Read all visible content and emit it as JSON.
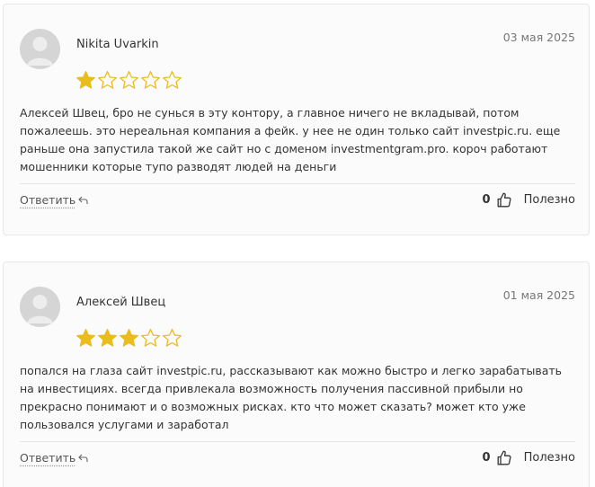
{
  "reviews": [
    {
      "author": "Nikita Uvarkin",
      "date": "03 мая 2025",
      "rating": 1,
      "max_rating": 5,
      "text": "Алексей Швец, бро не суньcя в эту контору, а главное ничего не вкладывай, потом пожалеешь. это нереальная компания а фейк. у нее не один только сайт investpic.ru. еще раньше она запустила такой же сайт но с доменом investmentgram.pro. короч работают мошенники которые тупо разводят людей на деньги",
      "reply_label": "Ответить",
      "helpful_count": "0",
      "helpful_label": "Полезно"
    },
    {
      "author": "Алексей Швец",
      "date": "01 мая 2025",
      "rating": 3,
      "max_rating": 5,
      "text": "попался на глаза сайт investpic.ru, рассказывают как можно быстро и легко зарабатывать на инвестициях. всегда привлекала возможность получения пассивной прибыли но прекрасно понимают и о возможных рисках. кто что может сказать? может кто уже пользовался услугами и заработал",
      "reply_label": "Ответить",
      "helpful_count": "0",
      "helpful_label": "Полезно"
    }
  ],
  "colors": {
    "star_filled": "#E9BC1F",
    "star_empty_stroke": "#E9BC1F",
    "card_background": "#FBFBFB",
    "card_border": "#E7E7E7",
    "avatar_background": "#D5D5D5"
  },
  "icons": {
    "avatar": "user-silhouette-icon",
    "star": "star-icon",
    "reply": "reply-arrow-icon",
    "helpful": "thumbs-up-icon"
  }
}
